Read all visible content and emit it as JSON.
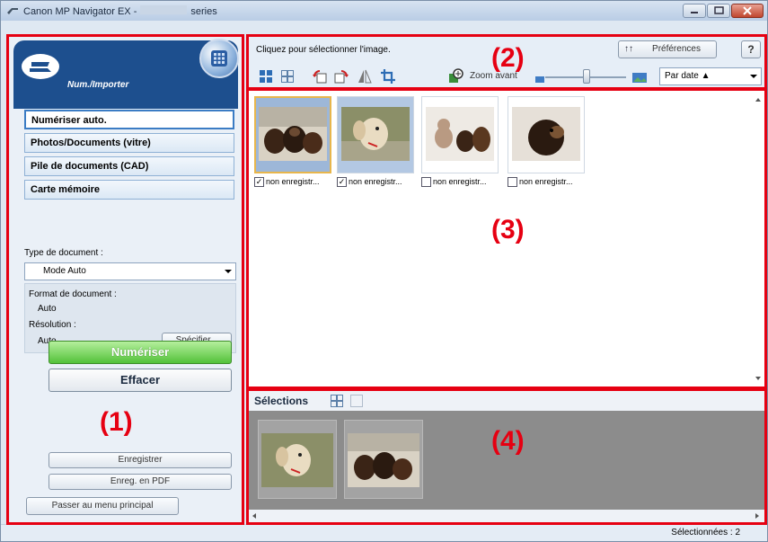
{
  "window": {
    "title_prefix": "Canon MP Navigator EX -",
    "title_suffix": "series"
  },
  "annotations": [
    "(1)",
    "(2)",
    "(3)",
    "(4)"
  ],
  "left_panel": {
    "header_label": "Num./Importer",
    "menu_items": [
      {
        "label": "Numériser auto.",
        "active": true
      },
      {
        "label": "Photos/Documents (vitre)",
        "active": false
      },
      {
        "label": "Pile de documents (CAD)",
        "active": false
      },
      {
        "label": "Carte mémoire",
        "active": false
      }
    ],
    "doc_type_label": "Type de document :",
    "doc_type_value": "Mode Auto",
    "doc_size_label": "Format de document :",
    "doc_size_value": "Auto",
    "resolution_label": "Résolution :",
    "resolution_value": "Auto",
    "specify_button": "Spécifier...",
    "scan_button": "Numériser",
    "clear_button": "Effacer",
    "save_button": "Enregistrer",
    "save_pdf_button": "Enreg. en PDF",
    "main_menu_button": "Passer au menu principal"
  },
  "toolbar": {
    "hint": "Cliquez pour sélectionner l'image.",
    "preferences_button": "Préférences",
    "help_button": "?",
    "zoom_label": "Zoom avant",
    "sort_value": "Par date ▲"
  },
  "thumbnails": [
    {
      "caption": "non enregistr...",
      "checked": true
    },
    {
      "caption": "non enregistr...",
      "checked": true
    },
    {
      "caption": "non enregistr...",
      "checked": false
    },
    {
      "caption": "non enregistr...",
      "checked": false
    }
  ],
  "selections": {
    "title": "Sélections"
  },
  "status": {
    "selected_count": "Sélectionnées : 2"
  }
}
